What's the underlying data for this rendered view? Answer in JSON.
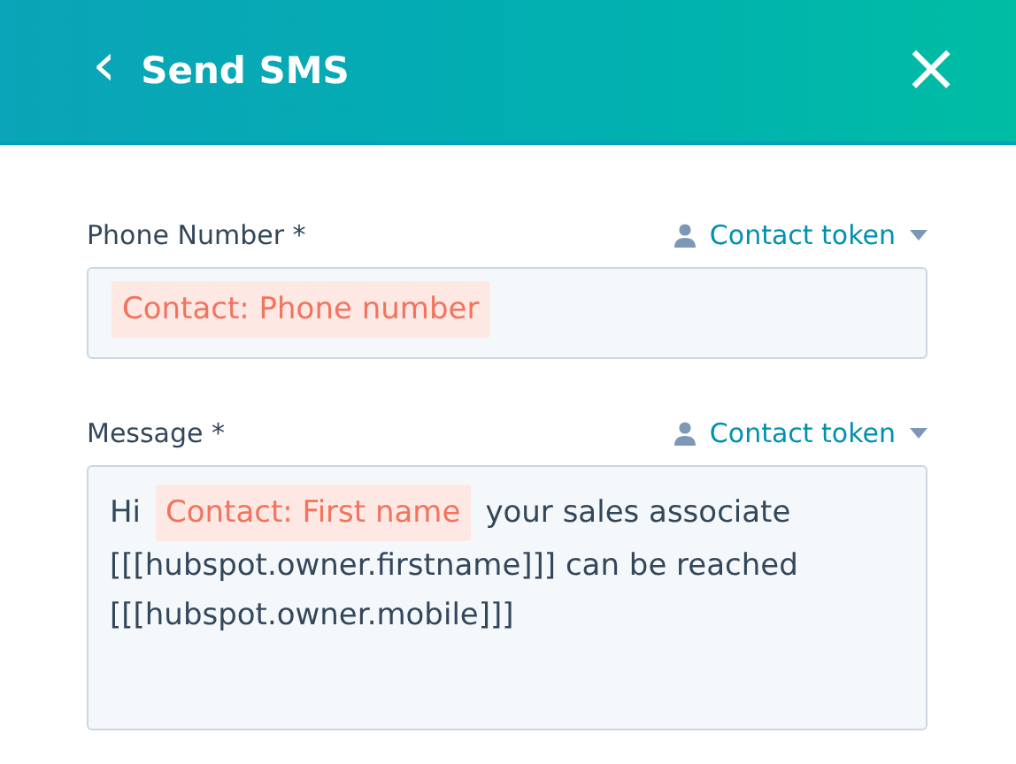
{
  "header": {
    "back": "‹",
    "title": "Send SMS",
    "close": "×"
  },
  "fields": [
    {
      "label": "Phone Number *",
      "token_menu": "Contact token",
      "kind": "single_line",
      "lines": [
        [
          {
            "kind": "token",
            "text": "Contact: Phone number"
          }
        ]
      ]
    },
    {
      "label": "Message *",
      "token_menu": "Contact token",
      "kind": "multi_line",
      "lines": [
        [
          {
            "kind": "text",
            "text": "Hi"
          },
          {
            "kind": "token",
            "text": "Contact: First name"
          },
          {
            "kind": "text",
            "text": "your sales associate"
          }
        ],
        [
          {
            "kind": "text",
            "text": "[[[hubspot.owner.firstname]]] can be reached"
          }
        ],
        [
          {
            "kind": "text",
            "text": "[[[hubspot.owner.mobile]]]"
          }
        ]
      ]
    }
  ]
}
